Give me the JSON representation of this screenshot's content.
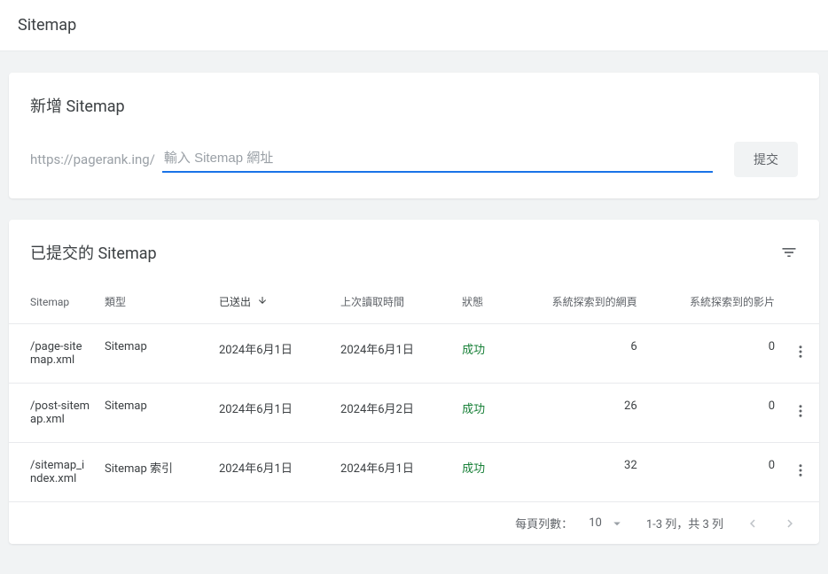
{
  "header": {
    "title": "Sitemap"
  },
  "addCard": {
    "title": "新增 Sitemap",
    "domainPrefix": "https://pagerank.ing/",
    "inputPlaceholder": "輸入 Sitemap 網址",
    "submitLabel": "提交"
  },
  "submittedCard": {
    "title": "已提交的 Sitemap",
    "columns": {
      "sitemap": "Sitemap",
      "type": "類型",
      "sent": "已送出",
      "lastRead": "上次讀取時間",
      "status": "狀態",
      "pages": "系統探索到的網頁",
      "videos": "系統探索到的影片"
    },
    "rows": [
      {
        "sitemap": "/page-sitemap.xml",
        "type": "Sitemap",
        "sent": "2024年6月1日",
        "lastRead": "2024年6月1日",
        "status": "成功",
        "pages": "6",
        "videos": "0"
      },
      {
        "sitemap": "/post-sitemap.xml",
        "type": "Sitemap",
        "sent": "2024年6月1日",
        "lastRead": "2024年6月2日",
        "status": "成功",
        "pages": "26",
        "videos": "0"
      },
      {
        "sitemap": "/sitemap_index.xml",
        "type": "Sitemap 索引",
        "sent": "2024年6月1日",
        "lastRead": "2024年6月1日",
        "status": "成功",
        "pages": "32",
        "videos": "0"
      }
    ],
    "pagination": {
      "rowsLabel": "每頁列數：",
      "rowsValue": "10",
      "range": "1-3 列，共 3 列"
    }
  }
}
